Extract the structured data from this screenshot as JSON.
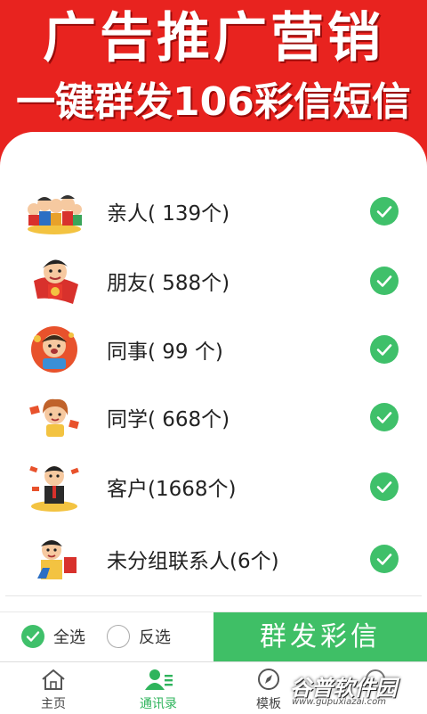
{
  "banner": {
    "line1": "广告推广营销",
    "line2": "一键群发106彩信短信"
  },
  "groups": [
    {
      "label": "亲人( 139个)",
      "avatar": "family-group-icon"
    },
    {
      "label": "朋友( 588个)",
      "avatar": "friend-superhero-icon"
    },
    {
      "label": "同事(  99 个)",
      "avatar": "colleague-icon"
    },
    {
      "label": "同学( 668个)",
      "avatar": "classmate-icon"
    },
    {
      "label": "客户(1668个)",
      "avatar": "customer-money-icon"
    },
    {
      "label": "未分组联系人(6个)",
      "avatar": "ungrouped-contact-icon"
    }
  ],
  "select_all": "全选",
  "invert_select": "反选",
  "send_button": "群发彩信",
  "tabs": [
    {
      "label": "主页",
      "icon": "home-icon"
    },
    {
      "label": "通讯录",
      "icon": "contacts-icon"
    },
    {
      "label": "模板",
      "icon": "compass-icon"
    },
    {
      "label": "",
      "icon": "more-icon"
    }
  ],
  "watermark": {
    "big": "谷普软件园",
    "small": "www.gupuxiazai.com"
  },
  "colors": {
    "banner_red": "#e8231f",
    "accent_green": "#3fbf66",
    "active_tab": "#2fb45c"
  }
}
